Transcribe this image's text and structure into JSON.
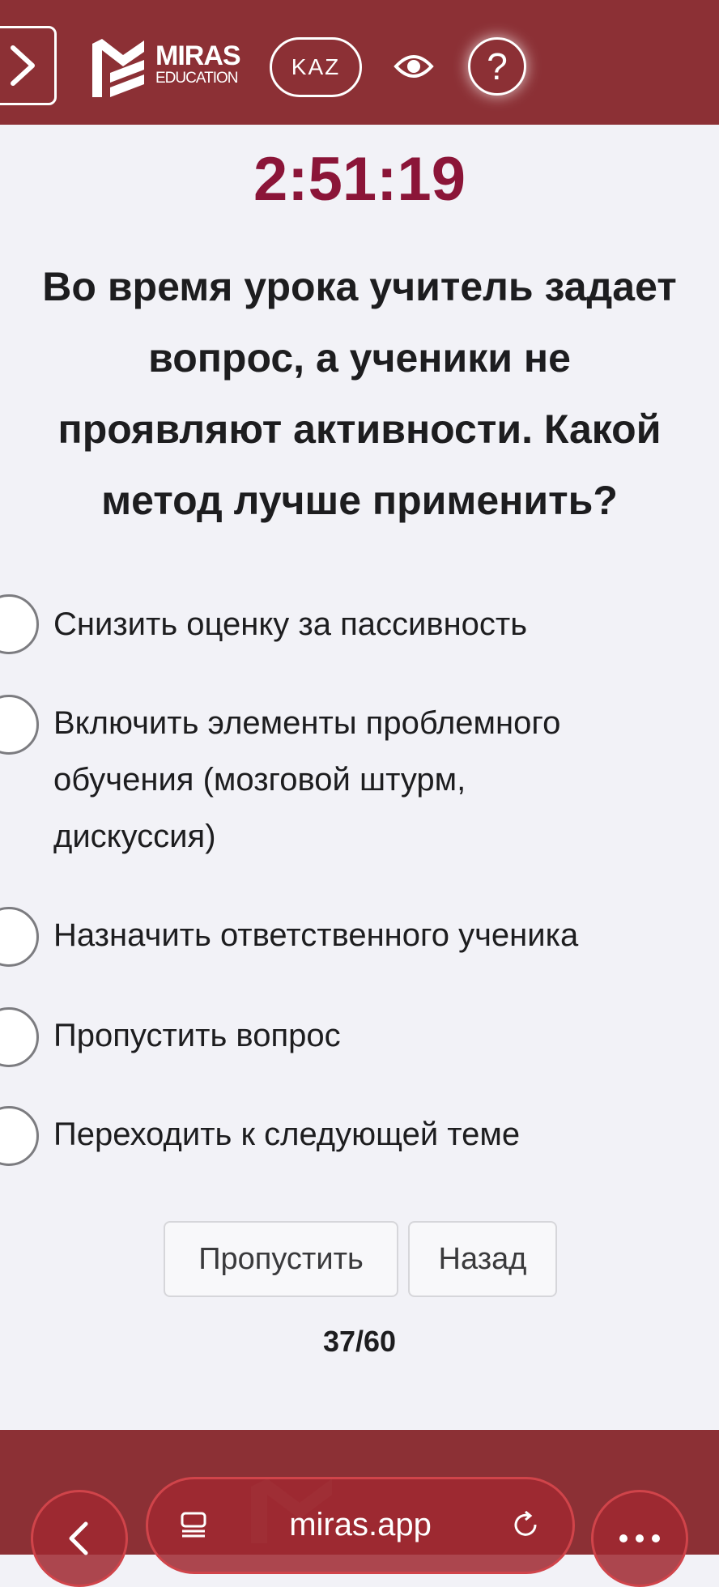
{
  "header": {
    "logo_title": "MIRAS",
    "logo_subtitle": "EDUCATION",
    "language": "KAZ",
    "help": "?"
  },
  "quiz": {
    "timer": "2:51:19",
    "question_lines": [
      "Во время урока учитель задает",
      "вопрос, а ученики не",
      "проявляют активности. Какой",
      "метод лучше применить?"
    ],
    "options": [
      {
        "lines": [
          "Снизить оценку за пассивность"
        ]
      },
      {
        "lines": [
          "Включить элементы проблемного",
          "обучения (мозговой штурм,",
          "дискуссия)"
        ]
      },
      {
        "lines": [
          "Назначить ответственного ученика"
        ]
      },
      {
        "lines": [
          "Пропустить вопрос"
        ]
      },
      {
        "lines": [
          "Переходить к следующей теме"
        ]
      }
    ],
    "skip_label": "Пропустить",
    "back_label": "Назад",
    "progress": "37/60"
  },
  "browser": {
    "url": "miras.app"
  },
  "colors": {
    "brand": "#8c3035",
    "timer": "#8b1538",
    "background": "#f2f2f7"
  }
}
